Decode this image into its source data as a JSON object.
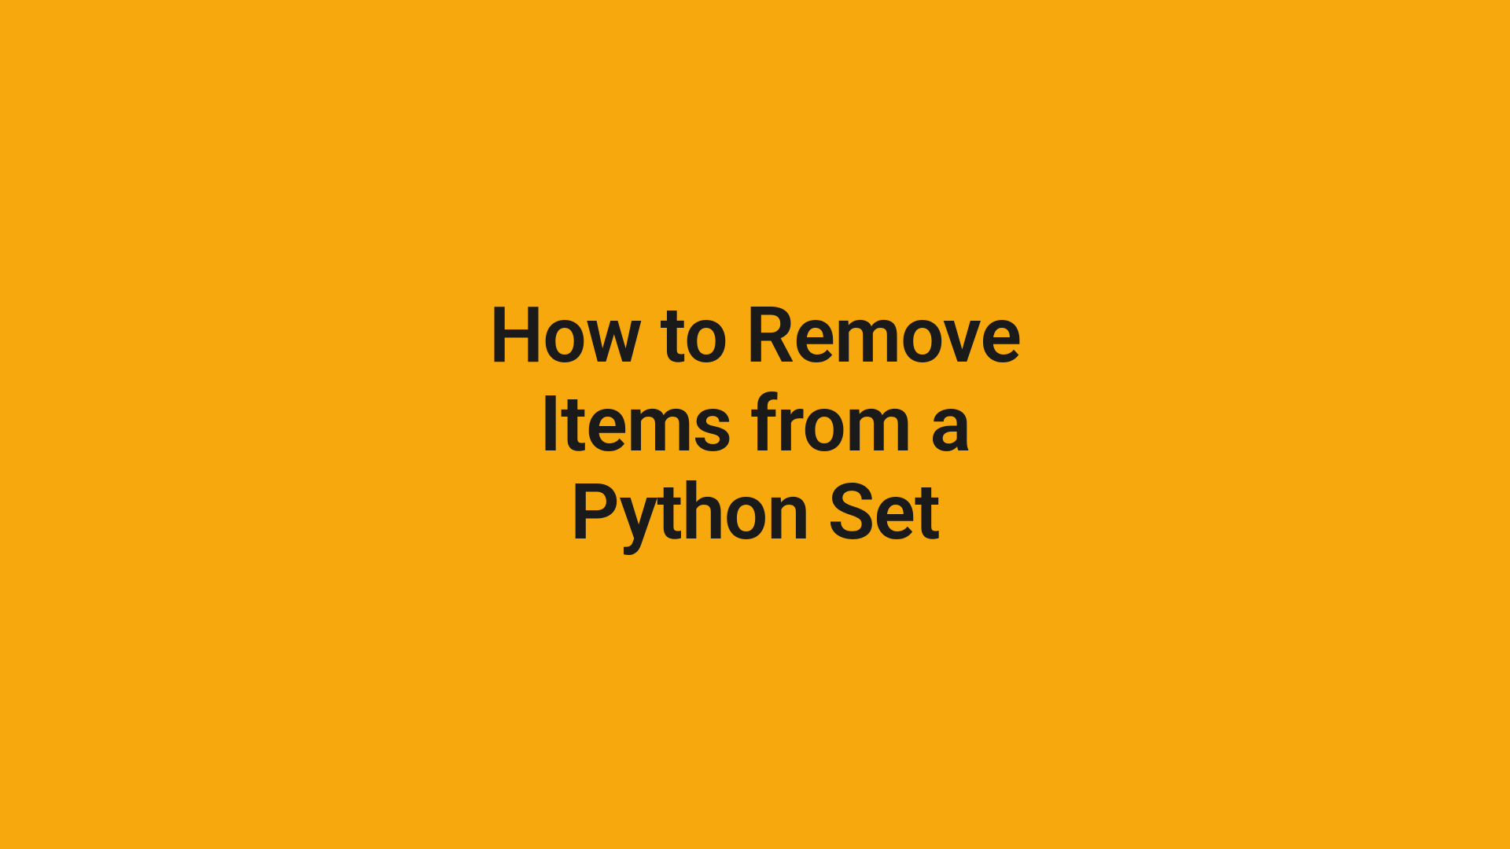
{
  "title": {
    "line1": "How to Remove",
    "line2": "Items from a",
    "line3": "Python Set"
  },
  "colors": {
    "background": "#f7a80c",
    "text": "#1a1a1a"
  }
}
